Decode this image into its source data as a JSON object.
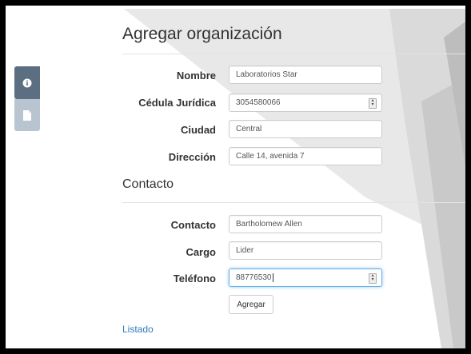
{
  "sidebar": {
    "tabs": [
      {
        "name": "info-tab",
        "icon": "info-icon",
        "state": "active"
      },
      {
        "name": "document-tab",
        "icon": "document-icon",
        "state": "inactive"
      }
    ]
  },
  "form": {
    "title": "Agregar organización",
    "fields": {
      "nombre": {
        "label": "Nombre",
        "value": "Laboratorios Star"
      },
      "cedula": {
        "label": "Cédula Jurídica",
        "value": "3054580066"
      },
      "ciudad": {
        "label": "Ciudad",
        "value": "Central"
      },
      "direccion": {
        "label": "Dirección",
        "value": "Calle 14, avenida 7"
      }
    },
    "contact_section": {
      "title": "Contacto",
      "fields": {
        "contacto": {
          "label": "Contacto",
          "value": "Bartholomew Allen"
        },
        "cargo": {
          "label": "Cargo",
          "value": "Lider"
        },
        "telefono": {
          "label": "Teléfono",
          "value": "88776530"
        }
      }
    },
    "submit_label": "Agregar",
    "list_link": "Listado"
  },
  "colors": {
    "sidebar_active": "#5b6e82",
    "sidebar_inactive": "#b9c4d1",
    "link": "#337ab7",
    "focus_border": "#66afe9"
  }
}
